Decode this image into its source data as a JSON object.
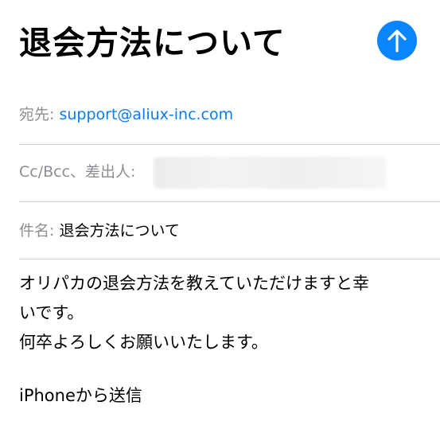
{
  "header": {
    "subject_title": "退会方法について",
    "send_icon": "arrow-up-icon",
    "accent_color": "#0a84ff"
  },
  "to_field": {
    "label": "宛先:",
    "recipient": "support@aliux-inc.com"
  },
  "cc_field": {
    "label": "Cc/Bcc、差出人:"
  },
  "subject_field": {
    "label": "件名:",
    "value": "退会方法について"
  },
  "body": {
    "lines": [
      "オリパカの退会方法を教えていただけますと幸",
      "いです。",
      "何卒よろしくお願いいたします。"
    ],
    "signature": "iPhoneから送信"
  }
}
